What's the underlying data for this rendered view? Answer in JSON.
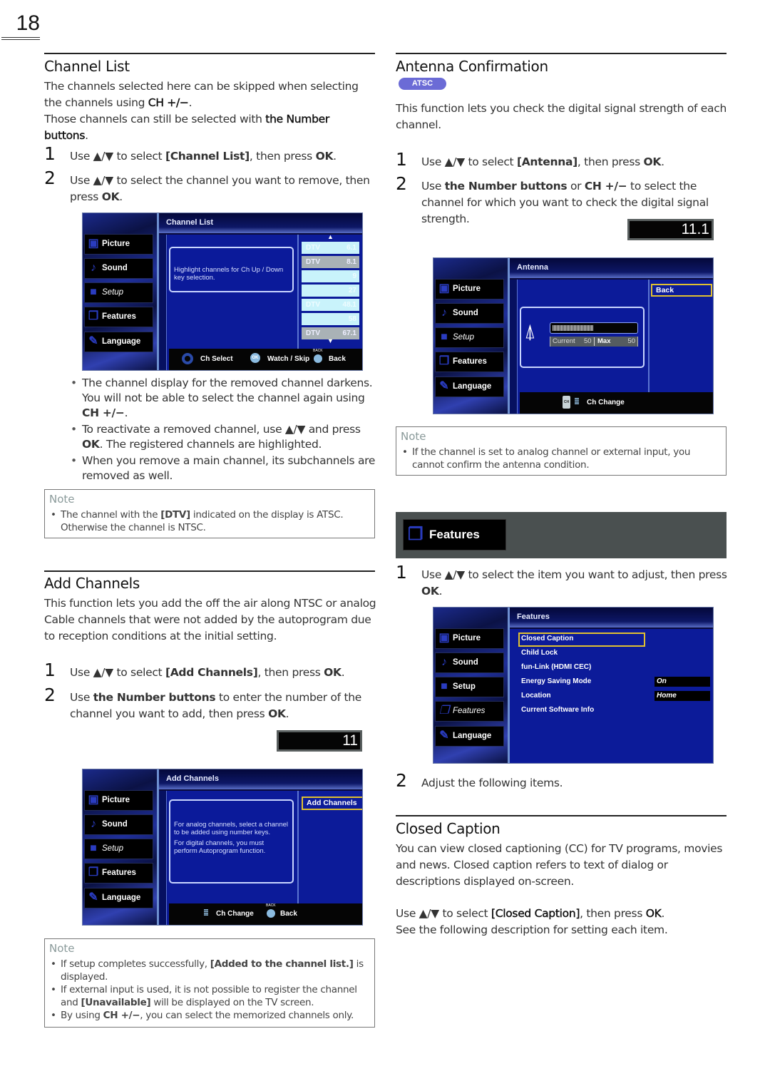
{
  "page_number": "18",
  "channel_list": {
    "heading": "Channel List",
    "intro_1a": "The channels selected here can be skipped when selecting the channels using ",
    "intro_1b": "CH +/−",
    "intro_1c": ".",
    "intro_2a": "Those channels can still be selected with ",
    "intro_2b": "the Number buttons",
    "intro_2c": ".",
    "steps": [
      {
        "num": "1",
        "a": "Use ▲/▼ to select ",
        "b": "[Channel List]",
        "c": ", then press ",
        "d": "OK",
        "e": "."
      },
      {
        "num": "2",
        "a": "Use ▲/▼ to select the channel you want to remove, then press ",
        "b": "OK",
        "c": "."
      }
    ],
    "screen": {
      "title": "Channel List",
      "info": "Highlight channels for Ch Up / Down key selection.",
      "channels": [
        {
          "type": "DTV",
          "number": "6.1",
          "state": "light"
        },
        {
          "type": "DTV",
          "number": "8.1",
          "state": "dark"
        },
        {
          "type": "",
          "number": "9",
          "state": "light"
        },
        {
          "type": "",
          "number": "27",
          "state": "light"
        },
        {
          "type": "DTV",
          "number": "48.1",
          "state": "light"
        },
        {
          "type": "",
          "number": "58",
          "state": "light"
        },
        {
          "type": "DTV",
          "number": "67.1",
          "state": "dark"
        }
      ],
      "footer": {
        "select": "Ch Select",
        "ok_icon": "OK",
        "watch": "Watch / Skip",
        "back_small": "BACK",
        "back": "Back"
      }
    },
    "bullets": [
      {
        "a": "The channel display for the removed channel darkens. You will not be able to select the channel again using ",
        "b": "CH +/−",
        "c": "."
      },
      {
        "a": "To reactivate a removed channel, use ▲/▼ and press ",
        "b": "OK",
        "c": ". The registered channels are highlighted."
      },
      {
        "a": "When you remove a main channel, its subchannels are removed as well.",
        "b": "",
        "c": ""
      }
    ],
    "note": {
      "title": "Note",
      "items": [
        {
          "a": "The channel with the ",
          "b": "[DTV]",
          "c": " indicated on the display is ATSC. Otherwise the channel is NTSC."
        }
      ]
    }
  },
  "menu_sidebar": {
    "picture": "Picture",
    "sound": "Sound",
    "setup": "Setup",
    "features": "Features",
    "language": "Language"
  },
  "add_channels": {
    "heading": "Add Channels",
    "intro": "This function lets you add the off the air along NTSC or analog Cable channels that were not added by the autoprogram due to reception conditions at the initial setting.",
    "steps": [
      {
        "num": "1",
        "a": "Use ▲/▼ to select ",
        "b": "[Add Channels]",
        "c": ", then press ",
        "d": "OK",
        "e": "."
      },
      {
        "num": "2",
        "a": "Use ",
        "b": "the Number buttons",
        "c": " to enter the number of the channel you want to add, then press ",
        "d": "OK",
        "e": "."
      }
    ],
    "channel_display": "11",
    "screen": {
      "title": "Add Channels",
      "info_1": "For analog channels, select a channel to be added using number keys.",
      "info_2": "For digital channels, you must perform Autoprogram function.",
      "button": "Add Channels",
      "footer": {
        "change": "Ch Change",
        "back_small": "BACK",
        "back": "Back"
      }
    },
    "note": {
      "title": "Note",
      "items": [
        {
          "a": "If setup completes successfully, ",
          "b": "[Added to the channel list.]",
          "c": " is displayed."
        },
        {
          "a": "If external input is used, it is not possible to register the channel and ",
          "b": "[Unavailable]",
          "c": " will be displayed on the TV screen."
        },
        {
          "a": "By using ",
          "b": "CH +/−",
          "c": ", you can select the memorized channels only."
        }
      ]
    }
  },
  "antenna": {
    "heading": "Antenna Confirmation",
    "badge": "ATSC",
    "badge_color": "#6b6bd6",
    "intro": "This function lets you check the digital signal strength of each channel.",
    "steps": [
      {
        "num": "1",
        "a": "Use ▲/▼ to select ",
        "b": "[Antenna]",
        "c": ", then press ",
        "d": "OK",
        "e": "."
      },
      {
        "num": "2",
        "a": "Use ",
        "b": "the Number buttons",
        "c": " or ",
        "d": "CH +/−",
        "e": " to select the channel for which you want to check the digital signal strength."
      }
    ],
    "channel_display": "11.1",
    "screen": {
      "title": "Antenna",
      "back": "Back",
      "current_label": "Current",
      "current_value": "50",
      "max_label": "Max",
      "max_value": "50",
      "signal_fraction": 0.5,
      "footer": {
        "ch_icon": "CH",
        "change": "Ch Change"
      }
    },
    "note": {
      "title": "Note",
      "items": [
        {
          "a": "If the channel is set to analog channel or external input, you cannot confirm the antenna condition."
        }
      ]
    }
  },
  "features": {
    "bar_label": "Features",
    "steps": [
      {
        "num": "1",
        "a": "Use ▲/▼ to select the item you want to adjust, then press ",
        "b": "OK",
        "c": "."
      },
      {
        "num": "2",
        "a": "Adjust the following items."
      }
    ],
    "screen": {
      "title": "Features",
      "items": [
        {
          "label": "Closed Caption",
          "value": ""
        },
        {
          "label": "Child Lock",
          "value": ""
        },
        {
          "label": "fun-Link (HDMI CEC)",
          "value": ""
        },
        {
          "label": "Energy Saving Mode",
          "value": "On"
        },
        {
          "label": "Location",
          "value": "Home"
        },
        {
          "label": "Current Software Info",
          "value": ""
        }
      ]
    }
  },
  "closed_caption": {
    "heading": "Closed Caption",
    "intro": "You can view closed captioning (CC) for TV programs, movies and news. Closed caption refers to text of dialog or descriptions displayed on-screen.",
    "instr_a": "Use ▲/▼ to select ",
    "instr_b": "[Closed Caption]",
    "instr_c": ", then press ",
    "instr_d": "OK",
    "instr_e": ".",
    "instr_2": "See the following description for setting each item."
  }
}
